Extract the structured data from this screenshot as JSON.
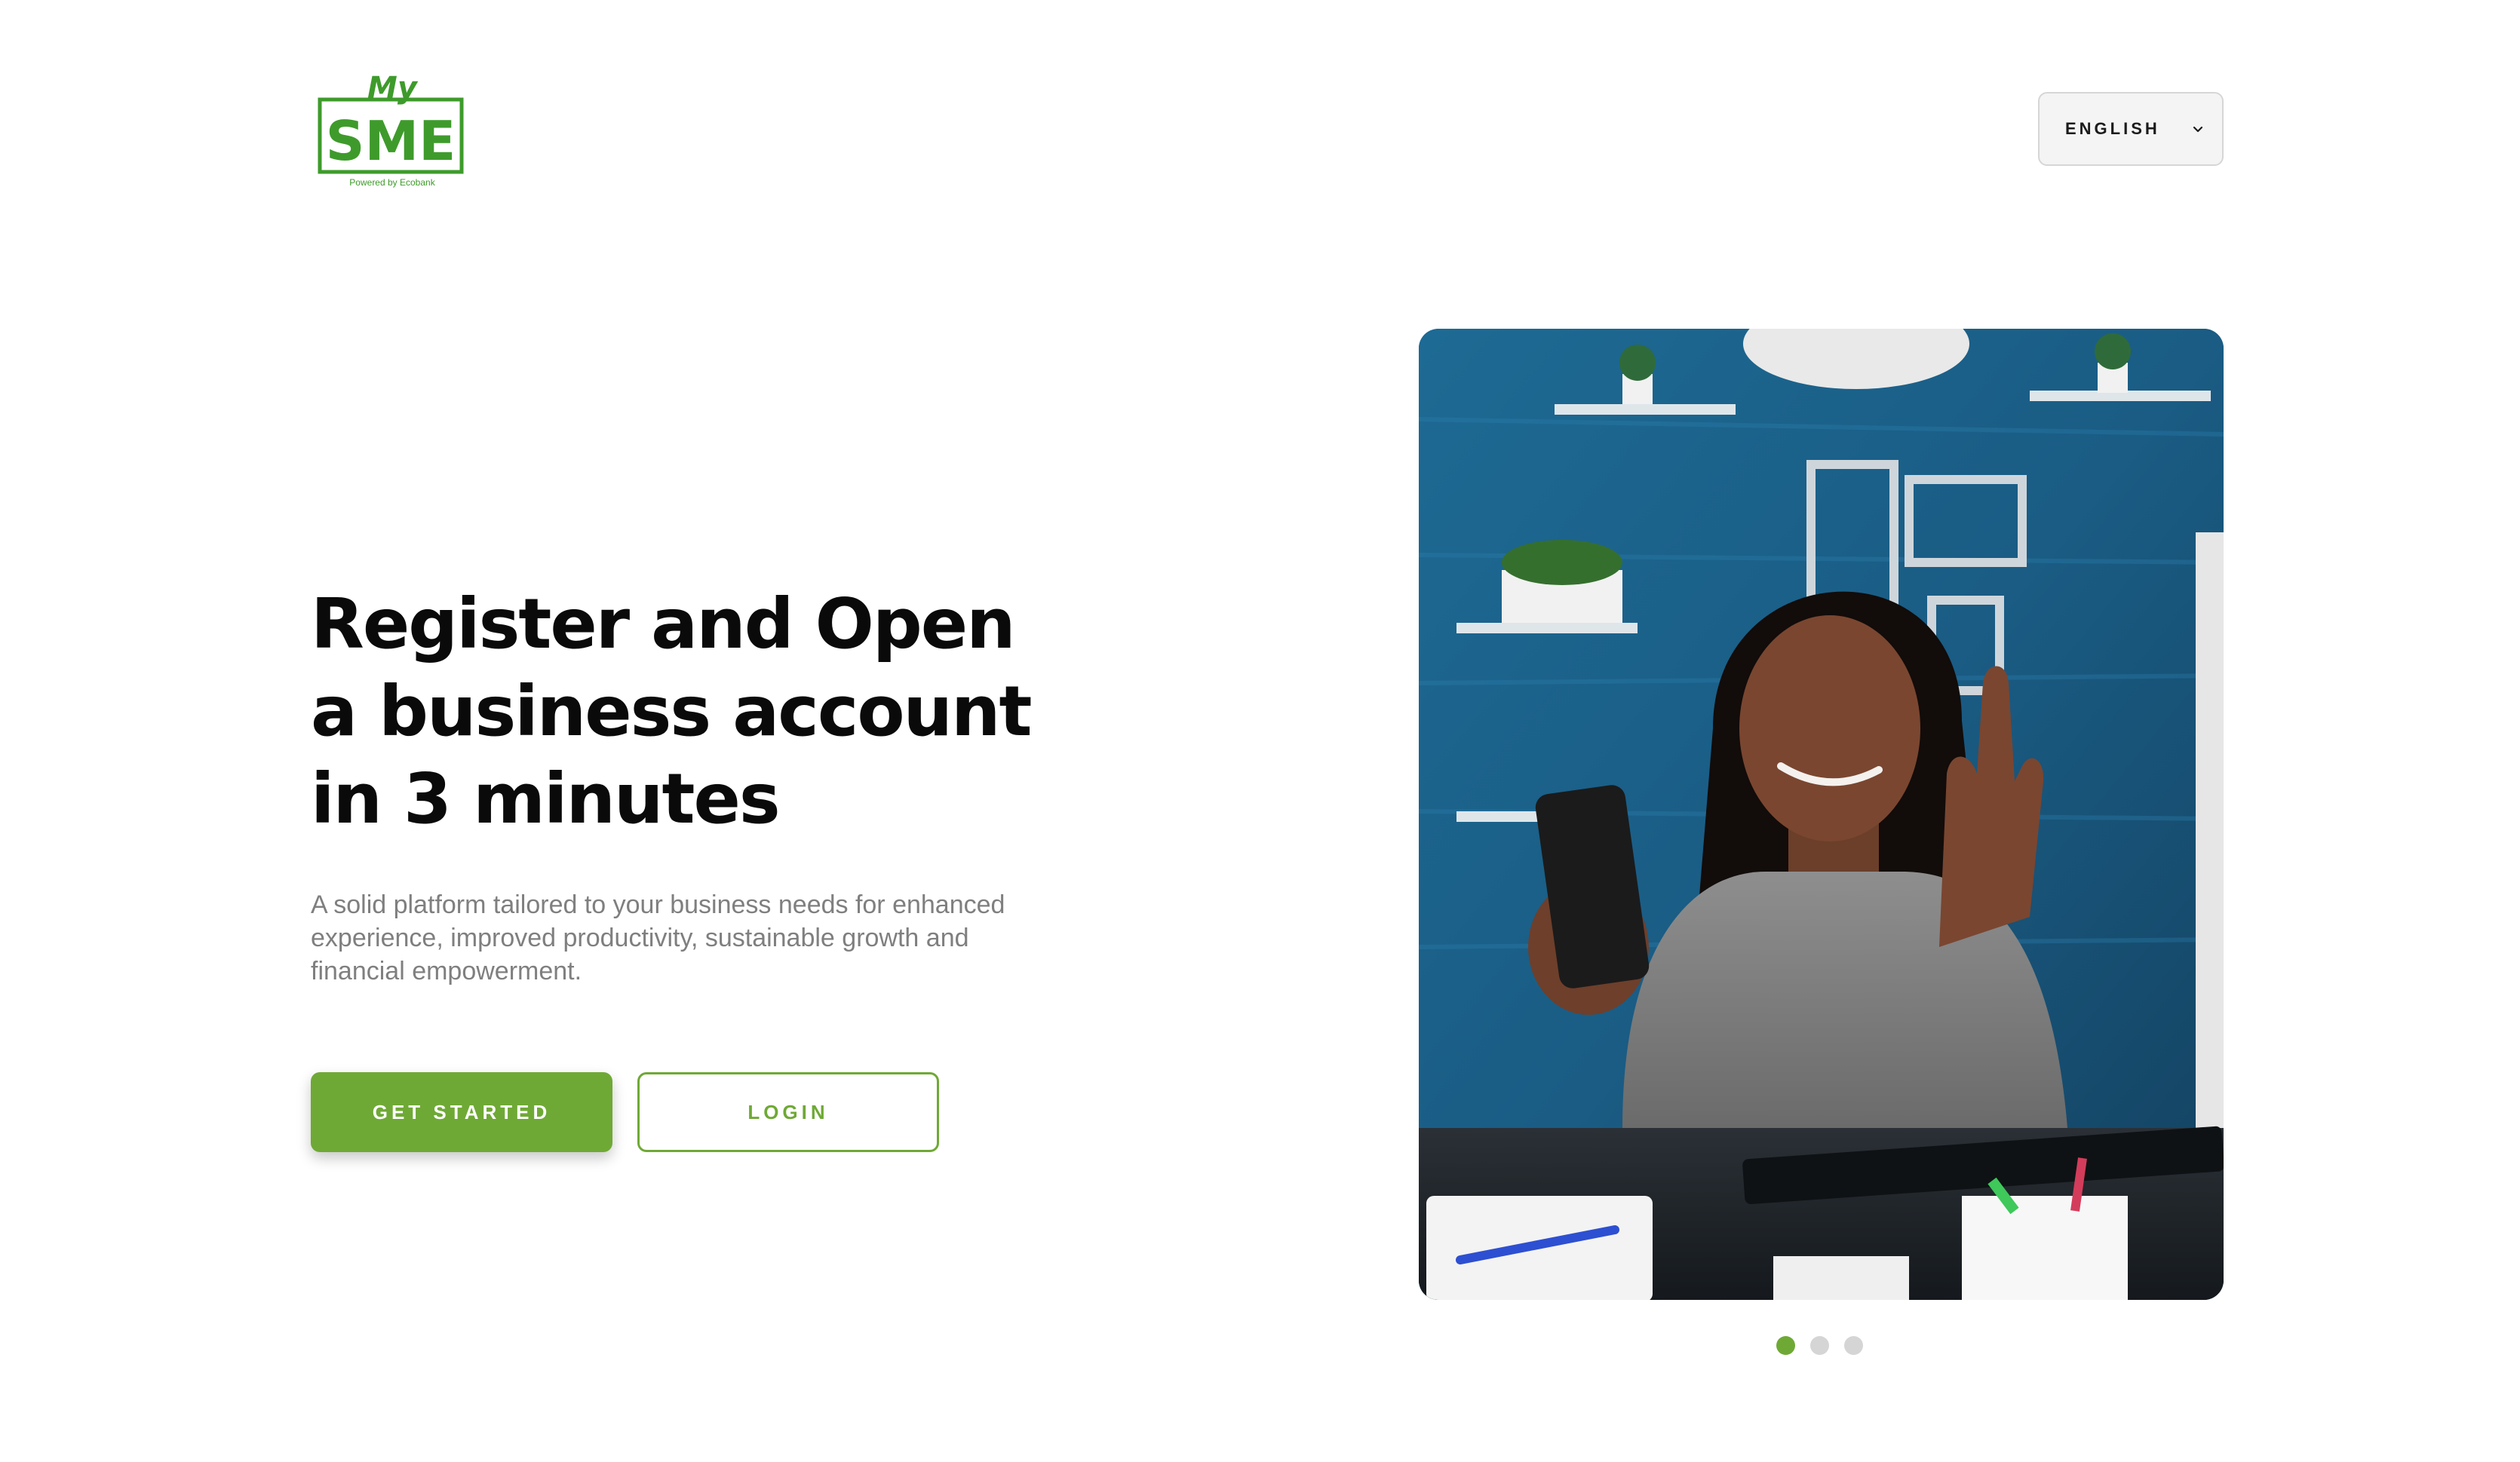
{
  "brand": {
    "logo_top": "My",
    "logo_main": "SME",
    "logo_tagline": "Powered by Ecobank",
    "color": "#3e9b2b"
  },
  "language": {
    "selected": "ENGLISH",
    "icon": "chevron-down-icon"
  },
  "hero": {
    "title_lines": [
      "Register and Open",
      "a business account",
      "in 3 minutes"
    ],
    "description": "A solid platform tailored to your business needs for enhanced experience, improved productivity, sustainable growth and financial empowerment."
  },
  "actions": {
    "get_started_label": "GET STARTED",
    "login_label": "LOGIN"
  },
  "carousel": {
    "slide_count": 3,
    "active_index": 0
  },
  "colors": {
    "accent": "#6fa935",
    "title": "#0a0a0a",
    "body_text": "#7f7f7f",
    "dot_inactive": "#d5d5d5"
  }
}
